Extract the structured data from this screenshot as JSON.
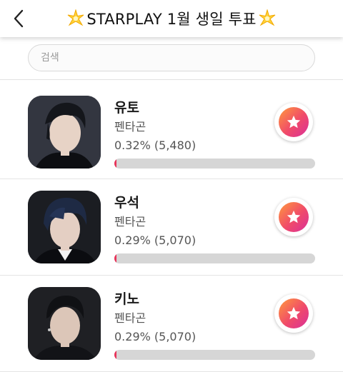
{
  "header": {
    "title": "STARPLAY 1월 생일 투표",
    "back_icon": "chevron-left-icon",
    "sparkle_icon": "sparkle-star-emoji"
  },
  "search": {
    "placeholder": "검색",
    "value": ""
  },
  "colors": {
    "accent_start": "#ff9a3c",
    "accent_mid": "#f04a6a",
    "accent_end": "#d9309a",
    "bar_track": "#d6d6d6",
    "bar_fill": "#e8345a"
  },
  "candidates": [
    {
      "name": "유토",
      "agency": "펜타곤",
      "stat": "0.32% (5,480)",
      "percent": 0.32
    },
    {
      "name": "우석",
      "agency": "펜타곤",
      "stat": "0.29% (5,070)",
      "percent": 0.29
    },
    {
      "name": "키노",
      "agency": "펜타곤",
      "stat": "0.29% (5,070)",
      "percent": 0.29
    }
  ]
}
